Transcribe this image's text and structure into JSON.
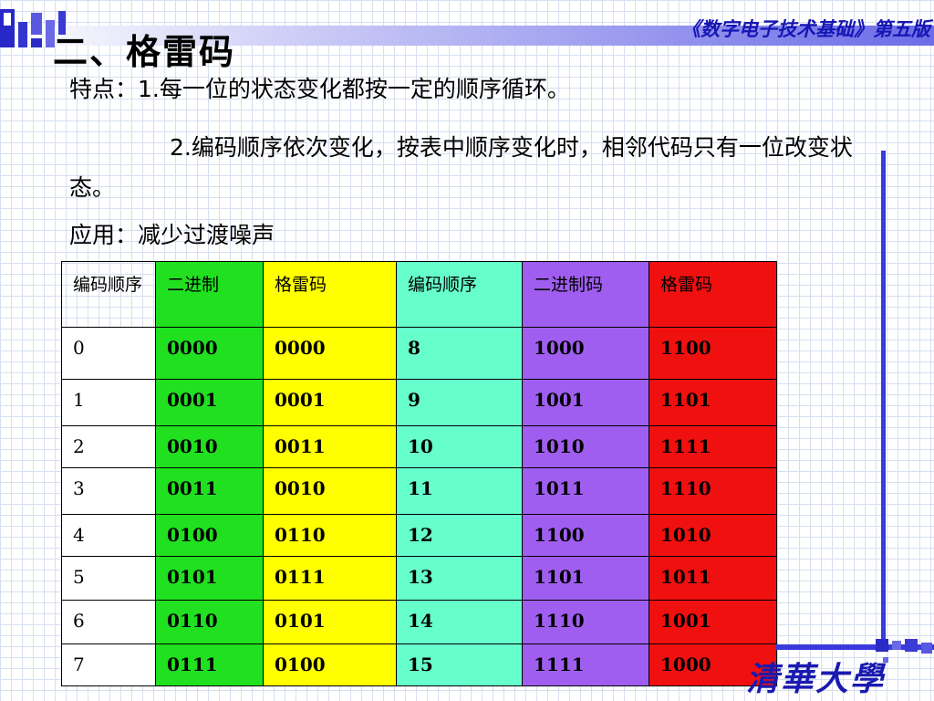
{
  "header": {
    "title": "二、格雷码",
    "book_title": "《数字电子技术基础》第五版"
  },
  "content": {
    "p1": "特点：1.每一位的状态变化都按一定的顺序循环。",
    "p2": "2.编码顺序依次变化，按表中顺序变化时，相邻代码只有一位改变状态。",
    "p3": "应用：减少过渡噪声"
  },
  "table": {
    "headers": [
      "编码顺序",
      "二进制",
      "格雷码",
      "编码顺序",
      "二进制码",
      "格雷码"
    ],
    "header_colors": [
      "#ffffff",
      "#20e020",
      "#ffff00",
      "#66ffcc",
      "#a05ef0",
      "#f01010"
    ],
    "rows": [
      [
        "0",
        "0000",
        "0000",
        "8",
        "1000",
        "1100"
      ],
      [
        "1",
        "0001",
        "0001",
        "9",
        "1001",
        "1101"
      ],
      [
        "2",
        "0010",
        "0011",
        "10",
        "1010",
        "1111"
      ],
      [
        "3",
        "0011",
        "0010",
        "11",
        "1011",
        "1110"
      ],
      [
        "4",
        "0100",
        "0110",
        "12",
        "1100",
        "1010"
      ],
      [
        "5",
        "0101",
        "0111",
        "13",
        "1101",
        "1011"
      ],
      [
        "6",
        "0110",
        "0101",
        "14",
        "1110",
        "1001"
      ],
      [
        "7",
        "0111",
        "0100",
        "15",
        "1111",
        "1000"
      ]
    ]
  },
  "colors": {
    "accent_blue": "#3a3ade",
    "book_title": "#1616b4"
  },
  "logo": {
    "text": "清華大學",
    "icon": "tsinghua-logo-icon"
  }
}
